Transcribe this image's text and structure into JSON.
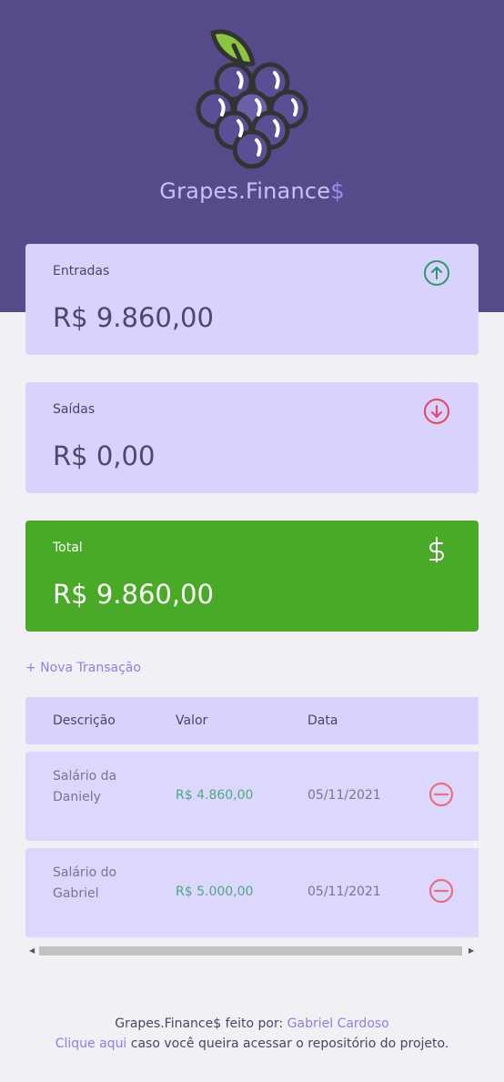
{
  "header": {
    "brand_name": "Grapes.Finance",
    "brand_suffix": "$",
    "logo_icon": "grapes-icon"
  },
  "cards": {
    "income": {
      "label": "Entradas",
      "value": "R$ 9.860,00",
      "icon": "arrow-up-circle-icon",
      "icon_color": "#2b9a6c"
    },
    "expense": {
      "label": "Saídas",
      "value": "R$ 0,00",
      "icon": "arrow-down-circle-icon",
      "icon_color": "#e5455e"
    },
    "total": {
      "label": "Total",
      "value": "R$ 9.860,00",
      "icon": "dollar-sign-icon",
      "bg_color": "#49aa28"
    }
  },
  "new_transaction_label": "+ Nova Transação",
  "table": {
    "headers": [
      "Descrição",
      "Valor",
      "Data"
    ],
    "rows": [
      {
        "description": "Salário da Daniely",
        "value": "R$ 4.860,00",
        "date": "05/11/2021"
      },
      {
        "description": "Salário do Gabriel",
        "value": "R$ 5.000,00",
        "date": "05/11/2021"
      }
    ]
  },
  "footer": {
    "line1_text": "Grapes.Finance$ feito por: ",
    "line1_link": "Gabriel Cardoso",
    "line2_link": "Clique aqui",
    "line2_text": " caso você queira acessar o repositório do projeto."
  },
  "colors": {
    "header_bg": "#554a8a",
    "card_bg": "#d8d2fc",
    "accent": "#8b80e8",
    "positive": "#4ea883",
    "danger": "#e5455e"
  }
}
